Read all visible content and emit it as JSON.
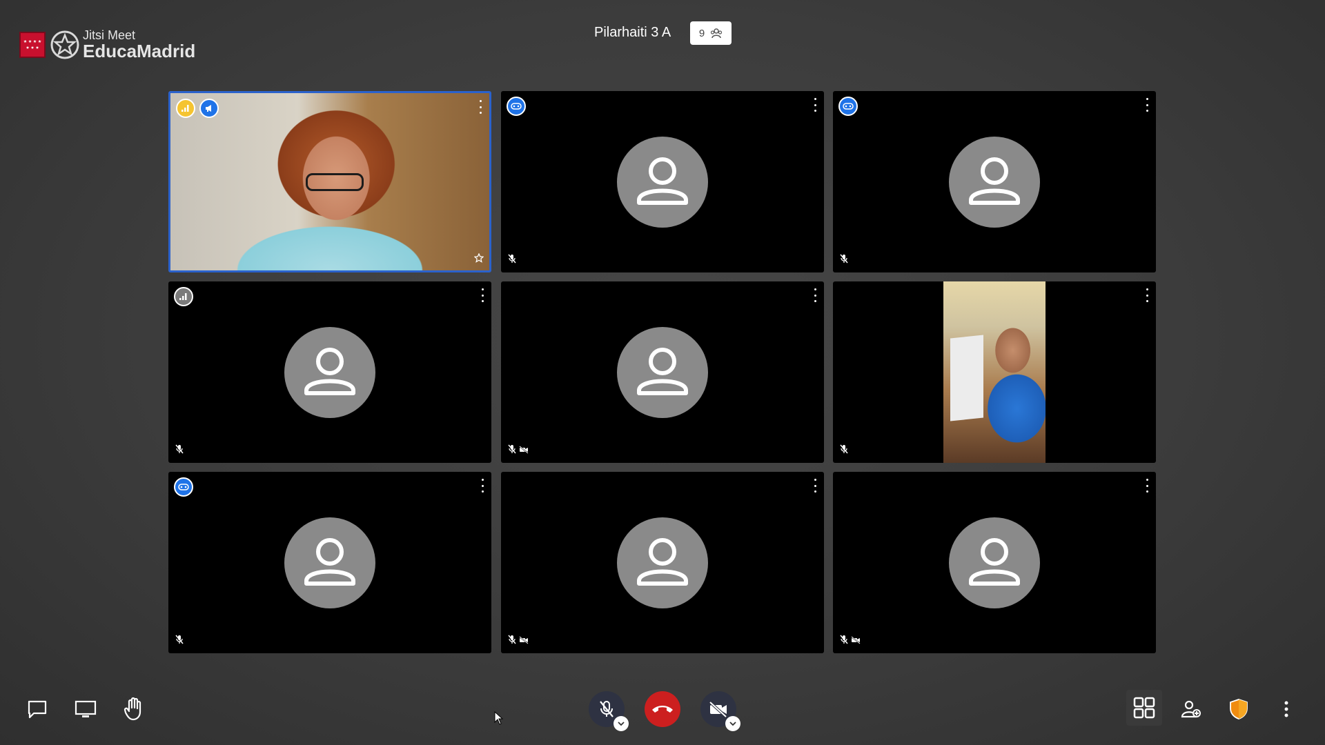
{
  "brand": {
    "product": "Jitsi Meet",
    "name": "EducaMadrid"
  },
  "room": {
    "title": "Pilarhaiti 3 A",
    "participant_count": "9"
  },
  "colors": {
    "active_border": "#2b62cc",
    "hangup": "#cc1f1f",
    "badge_blue": "#1f73e8",
    "badge_yellow": "#f5c431"
  },
  "tiles": [
    {
      "id": "tile-1",
      "video": "woman",
      "badges": [
        "signal-yellow",
        "moderator-blue"
      ],
      "muted": false,
      "video_off": false,
      "active": true,
      "pinned_star": true
    },
    {
      "id": "tile-2",
      "video": "avatar",
      "badges": [
        "remote-blue"
      ],
      "muted": true,
      "video_off": false
    },
    {
      "id": "tile-3",
      "video": "avatar",
      "badges": [
        "remote-blue"
      ],
      "muted": true,
      "video_off": false
    },
    {
      "id": "tile-4",
      "video": "avatar",
      "badges": [
        "signal-grey"
      ],
      "muted": true,
      "video_off": false
    },
    {
      "id": "tile-5",
      "video": "avatar",
      "badges": [],
      "muted": true,
      "video_off": true
    },
    {
      "id": "tile-6",
      "video": "girl",
      "badges": [],
      "muted": true,
      "video_off": false
    },
    {
      "id": "tile-7",
      "video": "avatar",
      "badges": [
        "remote-blue"
      ],
      "muted": true,
      "video_off": false
    },
    {
      "id": "tile-8",
      "video": "avatar",
      "badges": [],
      "muted": true,
      "video_off": true
    },
    {
      "id": "tile-9",
      "video": "avatar",
      "badges": [],
      "muted": true,
      "video_off": true
    }
  ],
  "toolbar": {
    "left": [
      "chat-icon",
      "screen-share-icon",
      "raise-hand-icon"
    ],
    "center": [
      "mic-muted-icon",
      "hangup-icon",
      "camera-off-icon"
    ],
    "right": [
      "tile-view-icon",
      "invite-icon",
      "security-shield-icon",
      "more-icon"
    ]
  }
}
